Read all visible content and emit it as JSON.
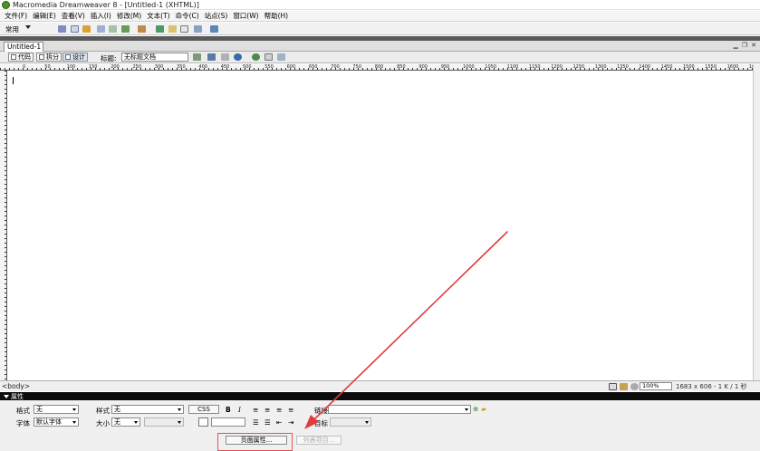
{
  "window": {
    "title": "Macromedia Dreamweaver 8 - [Untitled-1 (XHTML)]"
  },
  "menubar": {
    "items": [
      "文件(F)",
      "编辑(E)",
      "查看(V)",
      "插入(I)",
      "修改(M)",
      "文本(T)",
      "命令(C)",
      "站点(S)",
      "窗口(W)",
      "帮助(H)"
    ]
  },
  "insert_toolbar": {
    "category": "常用",
    "icons": [
      "hyperlink-icon",
      "email-link-icon",
      "named-anchor-icon",
      "table-icon",
      "layer-icon",
      "image-icon",
      "media-icon",
      "date-icon",
      "server-include-icon",
      "comment-icon",
      "head-icon",
      "template-icon",
      "tag-chooser-icon"
    ]
  },
  "document": {
    "tab_label": "Untitled-1",
    "view_code": "代码",
    "view_split": "拆分",
    "view_design": "设计",
    "title_label": "标题:",
    "title_value": "无标题文档"
  },
  "ruler": {
    "labels": [
      "0",
      "50",
      "100",
      "150",
      "200",
      "250",
      "300",
      "350",
      "400",
      "450",
      "500",
      "550",
      "600",
      "650",
      "700",
      "750",
      "800",
      "850",
      "900",
      "950",
      "1000",
      "1050",
      "1100",
      "1150",
      "1200",
      "1250",
      "1300",
      "1350",
      "1400",
      "1450",
      "1500",
      "1550",
      "1600",
      "1650"
    ]
  },
  "statusbar": {
    "tag": "<body>",
    "zoom": "100%",
    "size": "1683 x 606 - 1 K / 1 秒"
  },
  "properties": {
    "header": "属性",
    "format_label": "格式",
    "format_value": "无",
    "style_label": "样式",
    "style_value": "无",
    "css_button": "CSS",
    "bold": "B",
    "italic": "I",
    "link_label": "链接",
    "font_label": "字体",
    "font_value": "默认字体",
    "size_label": "大小",
    "size_value": "无",
    "target_label": "目标",
    "page_properties_button": "页面属性...",
    "list_item_button": "列表项目..."
  },
  "colors": {
    "annotation_red": "#e03c3c",
    "properties_header": "#0c0c0c"
  }
}
